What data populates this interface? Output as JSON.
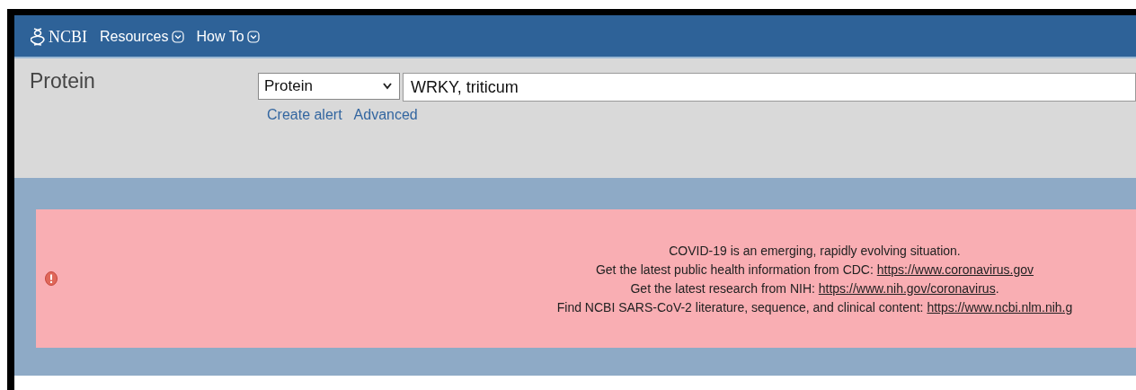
{
  "header": {
    "logo": "NCBI",
    "menus": [
      {
        "label": "Resources"
      },
      {
        "label": "How To"
      }
    ]
  },
  "search": {
    "title": "Protein",
    "database": "Protein",
    "query": "WRKY, triticum",
    "links": [
      "Create alert",
      "Advanced"
    ]
  },
  "notice": {
    "lines": [
      {
        "text": "COVID-19 is an emerging, rapidly evolving situation."
      },
      {
        "text": "Get the latest public health information from CDC: ",
        "link": "https://www.coronavirus.gov"
      },
      {
        "text": "Get the latest research from NIH: ",
        "link": "https://www.nih.gov/coronavirus",
        "after": "."
      },
      {
        "text": "Find NCBI SARS-CoV-2 literature, sequence, and clinical content: ",
        "link": "https://www.ncbi.nlm.nih.g"
      }
    ]
  }
}
